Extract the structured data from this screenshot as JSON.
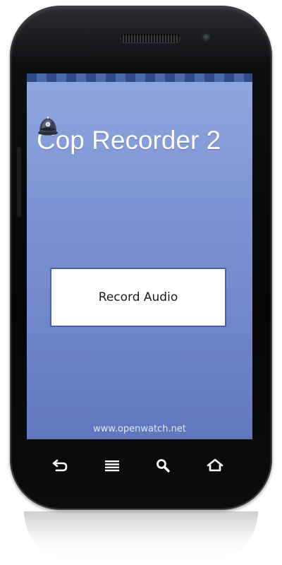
{
  "app": {
    "title": "Cop Recorder 2",
    "logo_icon": "police-helmet-icon",
    "record_button_label": "Record Audio",
    "footer_link": "www.openwatch.net"
  },
  "nav": {
    "icons": [
      "back-icon",
      "menu-icon",
      "search-icon",
      "home-icon"
    ]
  },
  "colors": {
    "screen_gradient_top": "#8fa8de",
    "screen_gradient_bottom": "#6077be",
    "button_border": "#4b5fa8",
    "phone_body": "#0a0b0d"
  }
}
